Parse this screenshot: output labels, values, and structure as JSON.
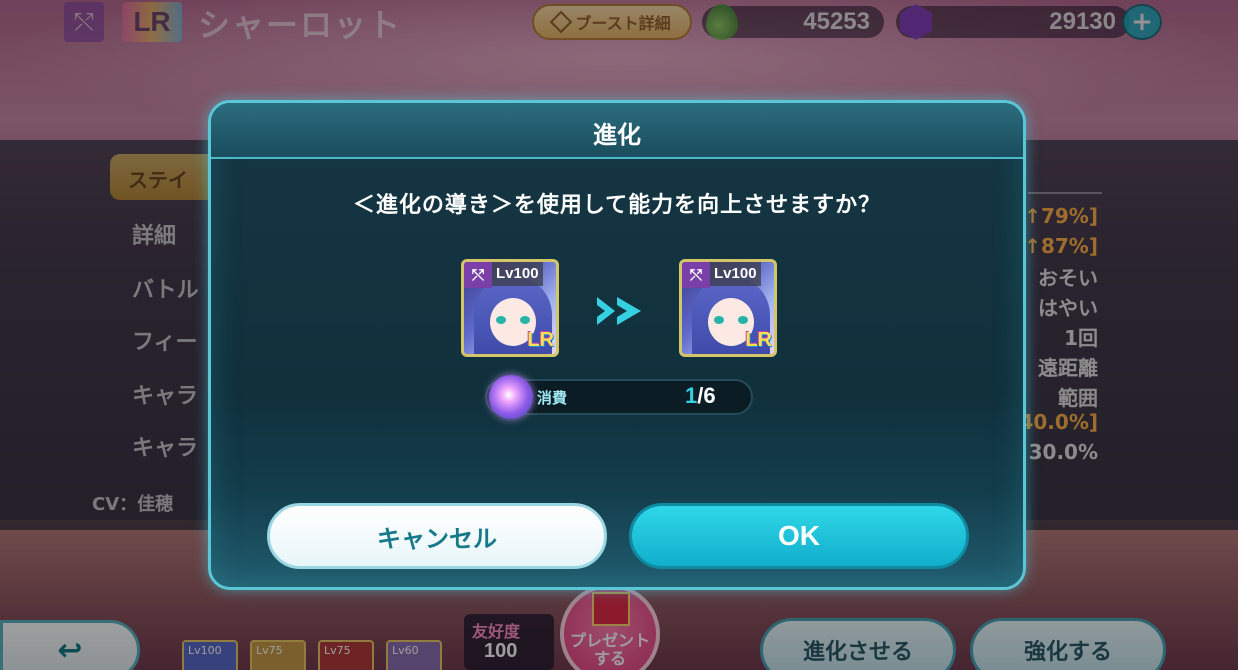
{
  "header": {
    "class_icon": "bow-icon",
    "rarity": "LR",
    "character_name": "シャーロット",
    "boost_label": "ブースト詳細",
    "gem_amount": "45253",
    "crystal_amount": "29130",
    "plus_label": "+"
  },
  "background_panel": {
    "tab_label": "ステイ",
    "rows": [
      "詳細",
      "バトル",
      "フィー",
      "キャラ",
      "キャラ"
    ],
    "values": [
      "[↑79%]",
      "[↑87%]",
      "おそい",
      "はやい",
      "1回",
      "遠距離",
      "範囲",
      "40.0%]",
      "30.0%"
    ],
    "cv_label": "CV：佳穂 ",
    "colors": {
      "orange": "#ffb04a"
    }
  },
  "bottom": {
    "back_icon": "return-arrow-icon",
    "mini_cards": [
      "Lv100",
      "Lv75",
      "Lv75",
      "Lv60"
    ],
    "like_title": "友好度",
    "like_value": "100",
    "present_label_1": "プレゼント",
    "present_label_2": "する",
    "evolve_label": "進化させる",
    "enhance_label": "強化する"
  },
  "modal": {
    "title": "進化",
    "question": "＜進化の導き＞を使用して能力を向上させますか？",
    "card_before": {
      "level": "Lv100",
      "rarity": "LR",
      "class_icon": "bow-icon"
    },
    "card_after": {
      "level": "Lv100",
      "rarity": "LR",
      "class_icon": "bow-icon"
    },
    "arrow_icon": "double-chevron-right-icon",
    "consume_label": "消費",
    "consume_current": "1",
    "consume_total": "/6",
    "cancel_label": "キャンセル",
    "ok_label": "OK",
    "accent_color": "#35d1e0"
  }
}
